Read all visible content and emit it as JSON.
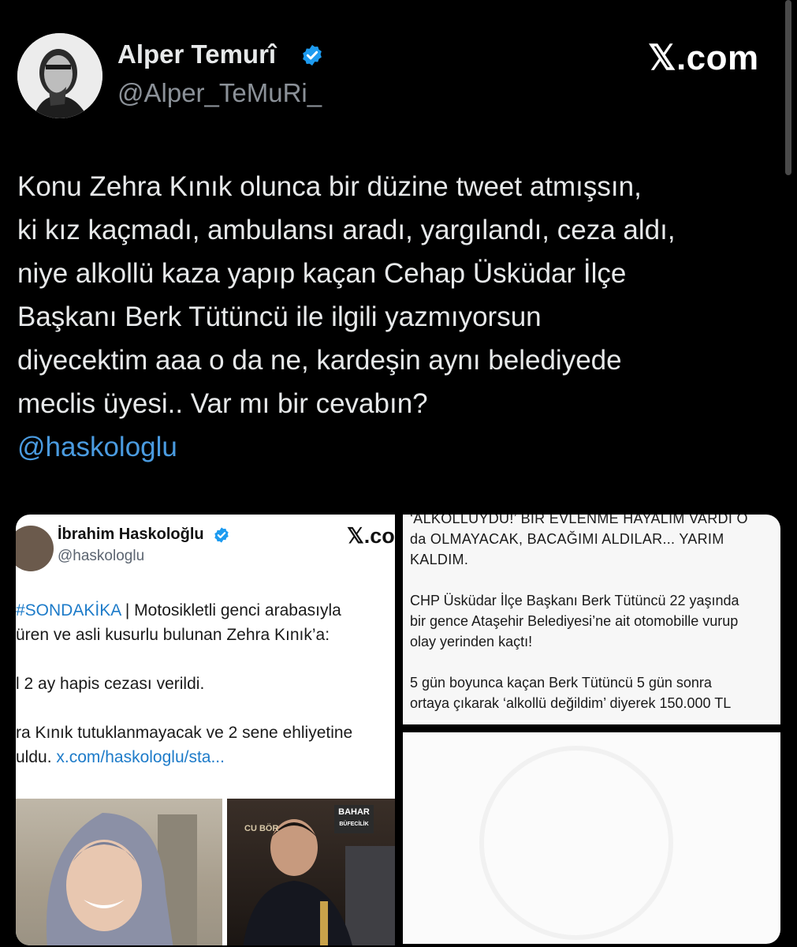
{
  "author": {
    "name": "Alper Temurî",
    "handle": "@Alper_TeMuRi_",
    "verified": true,
    "avatar_icon": "profile-avatar"
  },
  "brand": "𝕏.com",
  "tweet": {
    "lines": [
      "Konu Zehra Kınık olunca bir düzine tweet atmışsın,",
      "ki kız kaçmadı, ambulansı aradı, yargılandı, ceza aldı,",
      "niye alkollü kaza yapıp kaçan Cehap Üsküdar İlçe",
      "Başkanı Berk Tütüncü ile ilgili yazmıyorsun",
      "diyecektim aaa o da ne, kardeşin aynı belediyede",
      "meclis üyesi.. Var mı bir cevabın?"
    ],
    "mention": "@haskologlu"
  },
  "embedded_tweet": {
    "name": "İbrahim Haskoloğlu",
    "handle": "@haskologlu",
    "verified": true,
    "brand": "𝕏.co",
    "hashtag": "#SONDAKİKA",
    "line1_rest": " | Motosikletli genci arabasıyla",
    "line2": "üren ve asli kusurlu bulunan Zehra Kınık’a:",
    "line3": "l 2 ay hapis cezası verildi.",
    "line4": "ra Kınık tutuklanmayacak ve 2 sene ehliyetine",
    "line5_prefix": "uldu. ",
    "link": "x.com/haskologlu/sta...",
    "sign_bahar": "BAHAR",
    "sign_bufe": "BÜFECİLİK",
    "sign_shop": "CU BÖR"
  },
  "article": {
    "lines_top": [
      "‘ALKOLLUYDU!’ BIR EVLENME HAYALIM VARDI O",
      "da OLMAYACAK, BACAĞIMI ALDILAR... YARIM",
      "KALDIM."
    ],
    "lines_mid": [
      "CHP Üsküdar İlçe Başkanı Berk Tütüncü 22 yaşında",
      "bir gence Ataşehir Belediyesi’ne ait otomobille vurup",
      "olay yerinden kaçtı!"
    ],
    "lines_bottom": [
      "5 gün boyunca kaçan Berk Tütüncü 5 gün sonra",
      "ortaya çıkarak ‘alkollü değildim’ diyerek 150.000 TL"
    ]
  },
  "colors": {
    "background": "#000000",
    "text": "#e7e9ea",
    "handle": "#8b9198",
    "mention": "#4a9be0",
    "verified": "#1d9bf0"
  }
}
